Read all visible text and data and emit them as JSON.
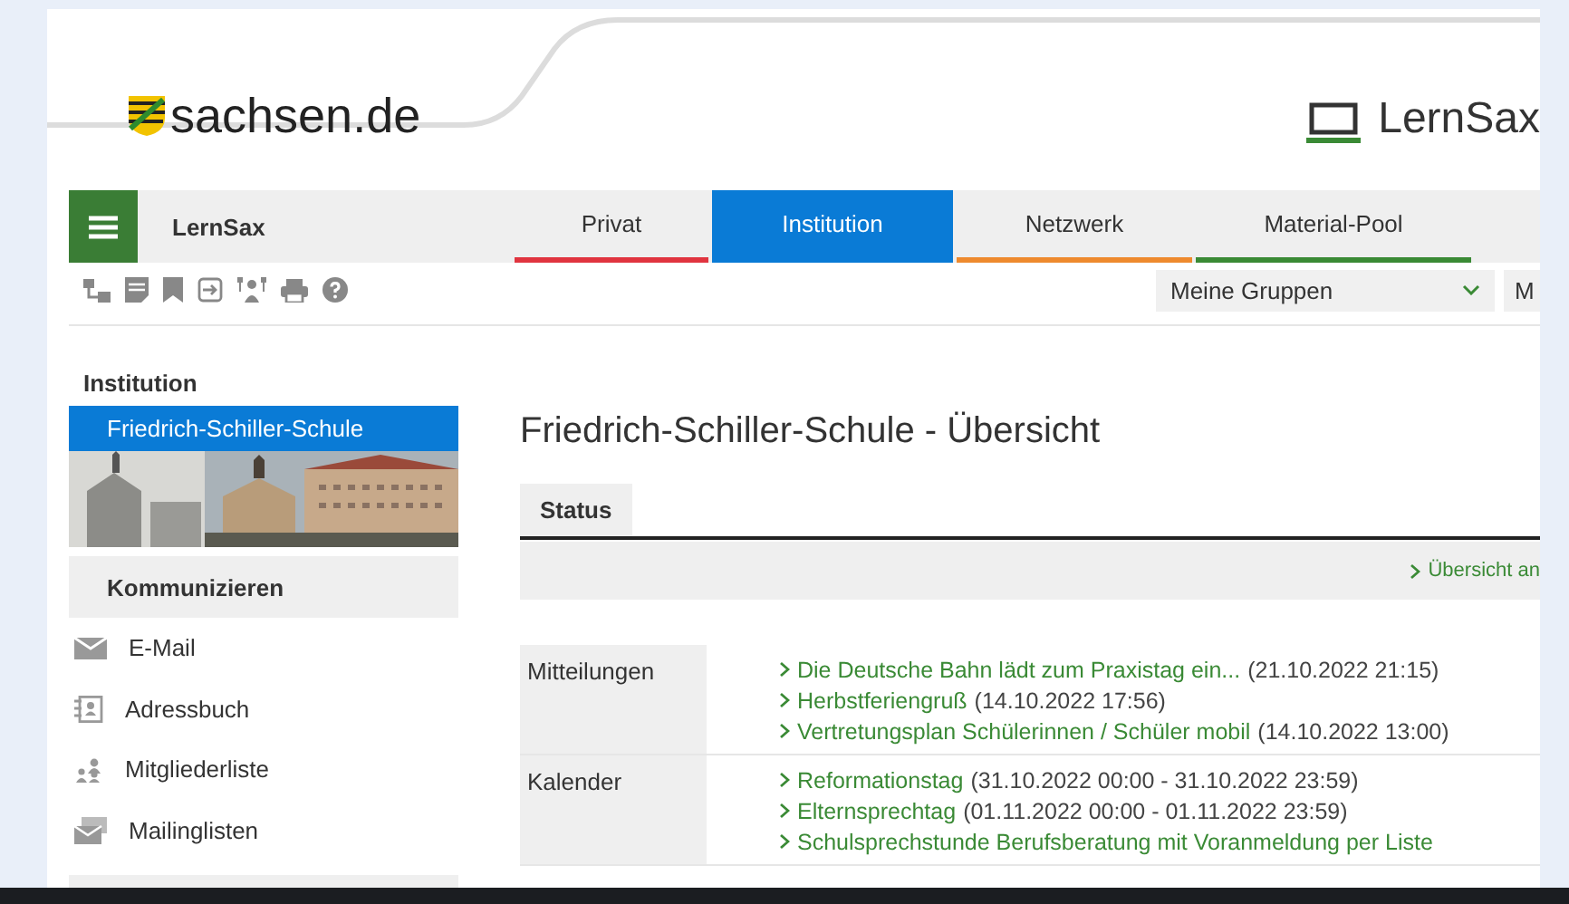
{
  "header": {
    "logo": "sachsen.de",
    "brand": "LernSax"
  },
  "nav": {
    "title": "LernSax",
    "tabs": [
      {
        "label": "Privat",
        "selected": false,
        "color": "#e0343f"
      },
      {
        "label": "Institution",
        "selected": true,
        "color": "#0a7bd6"
      },
      {
        "label": "Netzwerk",
        "selected": false,
        "color": "#ee8a2e"
      },
      {
        "label": "Material-Pool",
        "selected": false,
        "color": "#3a8a35"
      }
    ]
  },
  "selects": [
    {
      "value": "Meine Gruppen"
    },
    {
      "value": "M"
    }
  ],
  "sidebar": {
    "heading": "Institution",
    "items": [
      {
        "label": "Friedrich-Schiller-Schule",
        "selected": true
      }
    ],
    "sections": [
      {
        "title": "Kommunizieren",
        "items": [
          {
            "label": "E-Mail",
            "kind": "mail"
          },
          {
            "label": "Adressbuch",
            "kind": "addressbook"
          },
          {
            "label": "Mitgliederliste",
            "kind": "members"
          },
          {
            "label": "Mailinglisten",
            "kind": "mailinglist"
          }
        ]
      }
    ]
  },
  "main": {
    "title": "Friedrich-Schiller-Schule - Übersicht",
    "tabs": [
      {
        "label": "Status",
        "selected": true
      }
    ],
    "overview_link": "Übersicht an",
    "rows": [
      {
        "label": "Mitteilungen",
        "entries": [
          {
            "link": "Die Deutsche Bahn lädt zum Praxistag ein...",
            "date": "(21.10.2022 21:15)"
          },
          {
            "link": "Herbstferiengruß",
            "date": "(14.10.2022 17:56)"
          },
          {
            "link": "Vertretungsplan Schülerinnen / Schüler mobil",
            "date": "(14.10.2022 13:00)"
          }
        ]
      },
      {
        "label": "Kalender",
        "entries": [
          {
            "link": "Reformationstag",
            "date": "(31.10.2022 00:00 - 31.10.2022 23:59)"
          },
          {
            "link": "Elternsprechtag",
            "date": "(01.11.2022 00:00 - 01.11.2022 23:59)"
          },
          {
            "link": "Schulsprechstunde Berufsberatung mit Voranmeldung per Liste"
          }
        ]
      }
    ]
  }
}
